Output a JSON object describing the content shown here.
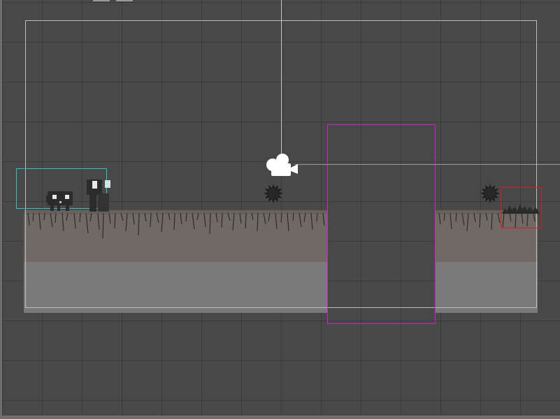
{
  "scene": {
    "grid_color": "#3c3c3c",
    "background_color": "#484848",
    "camera_bounds_color": "#bdbdbd",
    "selection_colors": {
      "player": "#27c6c6",
      "pit_trigger": "#d020d0",
      "hazard": "#e01a1a"
    }
  },
  "icons": {
    "camera": "camera-gizmo-icon",
    "enemy": "spiky-ball-icon",
    "player": "robot-character-icon",
    "hazard": "spike-trap-icon"
  }
}
